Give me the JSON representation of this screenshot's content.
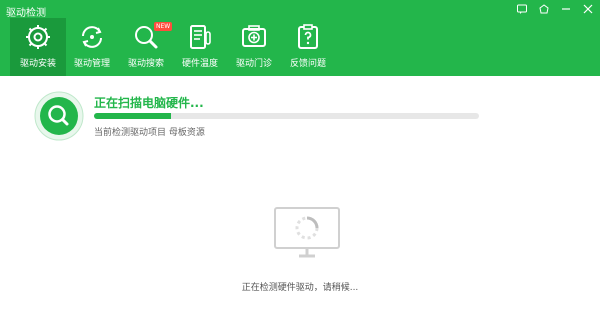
{
  "window": {
    "title": "驱动检测",
    "controls": [
      "feedback-icon",
      "skin-icon",
      "minimize-icon",
      "close-icon"
    ]
  },
  "nav": {
    "items": [
      {
        "label": "驱动安装",
        "icon": "gear-icon",
        "active": true
      },
      {
        "label": "驱动管理",
        "icon": "refresh-icon",
        "active": false
      },
      {
        "label": "驱动搜索",
        "icon": "search-icon",
        "active": false,
        "badge": "NEW"
      },
      {
        "label": "硬件温度",
        "icon": "hardware-icon",
        "active": false
      },
      {
        "label": "驱动门诊",
        "icon": "clinic-icon",
        "active": false
      },
      {
        "label": "反馈问题",
        "icon": "feedback-clipboard-icon",
        "active": false
      }
    ]
  },
  "scan": {
    "title": "正在扫描电脑硬件...",
    "subtitle": "当前检测驱动项目 母板资源",
    "progress": 0.2
  },
  "content": {
    "status_text": "正在检测硬件驱动，请稍候..."
  },
  "colors": {
    "brand": "#23b64b",
    "brand_dark": "#1a9a3c",
    "badge": "#ff4d3d"
  }
}
